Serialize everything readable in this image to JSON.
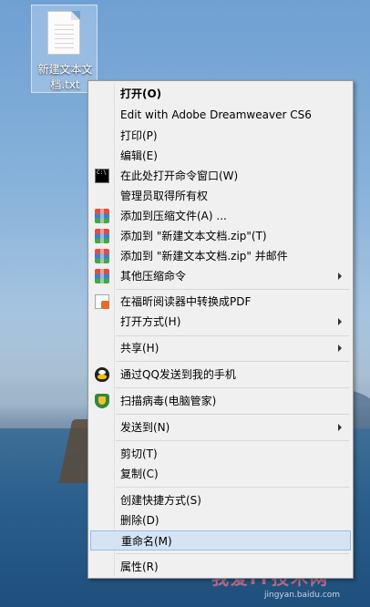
{
  "desktop": {
    "file": {
      "icon": "text-document-icon",
      "label_line1": "新建文本文",
      "label_line2": "档.txt"
    },
    "watermark": {
      "text": "我爱IT技术网",
      "url": "jingyan.baidu.com"
    }
  },
  "context_menu": {
    "highlighted": "重命名(M)",
    "items": [
      {
        "label": "打开(O)",
        "bold": true
      },
      {
        "label": "Edit with Adobe Dreamweaver CS6"
      },
      {
        "label": "打印(P)"
      },
      {
        "label": "编辑(E)"
      },
      {
        "label": "在此处打开命令窗口(W)",
        "icon": "command-prompt-icon"
      },
      {
        "label": "管理员取得所有权"
      },
      {
        "label": "添加到压缩文件(A) ...",
        "icon": "winrar-icon"
      },
      {
        "label": "添加到 \"新建文本文档.zip\"(T)",
        "icon": "winrar-icon"
      },
      {
        "label": "添加到 \"新建文本文档.zip\" 并邮件",
        "icon": "winrar-icon"
      },
      {
        "label": "其他压缩命令",
        "icon": "winrar-icon",
        "submenu": true
      },
      {
        "label": "在福昕阅读器中转换成PDF",
        "icon": "pdf-convert-icon"
      },
      {
        "label": "打开方式(H)",
        "submenu": true
      },
      {
        "label": "共享(H)",
        "submenu": true
      },
      {
        "label": "通过QQ发送到我的手机",
        "icon": "qq-icon"
      },
      {
        "label": "扫描病毒(电脑管家)",
        "icon": "shield-icon"
      },
      {
        "label": "发送到(N)",
        "submenu": true
      },
      {
        "label": "剪切(T)"
      },
      {
        "label": "复制(C)"
      },
      {
        "label": "创建快捷方式(S)"
      },
      {
        "label": "删除(D)"
      },
      {
        "label": "重命名(M)"
      },
      {
        "label": "属性(R)"
      }
    ]
  }
}
